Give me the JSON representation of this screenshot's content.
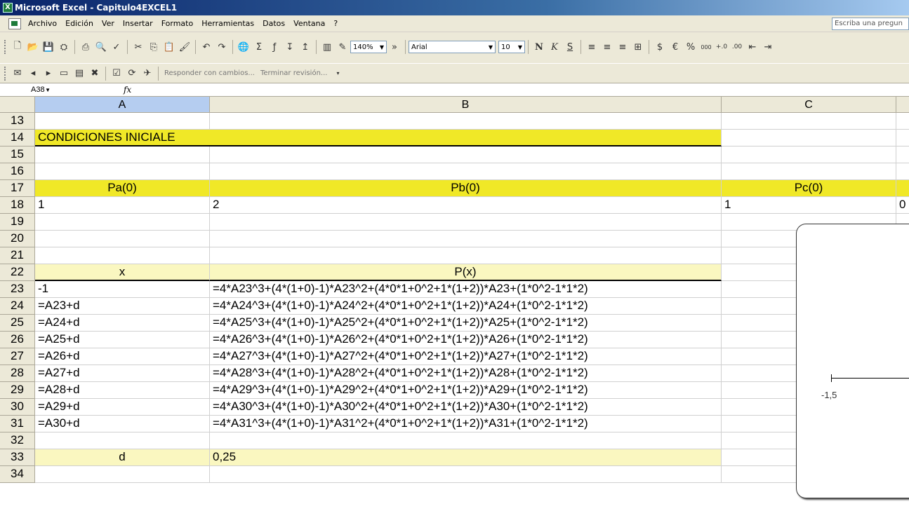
{
  "window": {
    "title": "Microsoft Excel - Capitulo4EXCEL1"
  },
  "menu": {
    "items": [
      "Archivo",
      "Edición",
      "Ver",
      "Insertar",
      "Formato",
      "Herramientas",
      "Datos",
      "Ventana",
      "?"
    ],
    "ask_placeholder": "Escriba una pregun"
  },
  "toolbar": {
    "zoom": "140%",
    "font": "Arial",
    "font_size": "10",
    "bold": "N",
    "italic": "K",
    "underline": "S",
    "review_reply": "Responder con cambios...",
    "review_end": "Terminar revisión..."
  },
  "formula_bar": {
    "name_box": "A38",
    "fx": "fx",
    "content": ""
  },
  "columns": [
    "A",
    "B",
    "C"
  ],
  "rows": [
    {
      "n": "13",
      "a": "",
      "b": "",
      "c": ""
    },
    {
      "n": "14",
      "a": "CONDICIONES INICIALE",
      "b": "",
      "c": ""
    },
    {
      "n": "15",
      "a": "",
      "b": "",
      "c": ""
    },
    {
      "n": "16",
      "a": "",
      "b": "",
      "c": ""
    },
    {
      "n": "17",
      "a": "Pa(0)",
      "b": "Pb(0)",
      "c": "Pc(0)"
    },
    {
      "n": "18",
      "a": "1",
      "b": "2",
      "c": "1",
      "d": "0"
    },
    {
      "n": "19",
      "a": "",
      "b": "",
      "c": ""
    },
    {
      "n": "20",
      "a": "",
      "b": "",
      "c": ""
    },
    {
      "n": "21",
      "a": "",
      "b": "",
      "c": ""
    },
    {
      "n": "22",
      "a": "x",
      "b": "P(x)",
      "c": ""
    },
    {
      "n": "23",
      "a": "-1",
      "b": "=4*A23^3+(4*(1+0)-1)*A23^2+(4*0*1+0^2+1*(1+2))*A23+(1*0^2-1*1*2)",
      "c": ""
    },
    {
      "n": "24",
      "a": "=A23+d",
      "b": "=4*A24^3+(4*(1+0)-1)*A24^2+(4*0*1+0^2+1*(1+2))*A24+(1*0^2-1*1*2)",
      "c": ""
    },
    {
      "n": "25",
      "a": "=A24+d",
      "b": "=4*A25^3+(4*(1+0)-1)*A25^2+(4*0*1+0^2+1*(1+2))*A25+(1*0^2-1*1*2)",
      "c": ""
    },
    {
      "n": "26",
      "a": "=A25+d",
      "b": "=4*A26^3+(4*(1+0)-1)*A26^2+(4*0*1+0^2+1*(1+2))*A26+(1*0^2-1*1*2)",
      "c": ""
    },
    {
      "n": "27",
      "a": "=A26+d",
      "b": "=4*A27^3+(4*(1+0)-1)*A27^2+(4*0*1+0^2+1*(1+2))*A27+(1*0^2-1*1*2)",
      "c": ""
    },
    {
      "n": "28",
      "a": "=A27+d",
      "b": "=4*A28^3+(4*(1+0)-1)*A28^2+(4*0*1+0^2+1*(1+2))*A28+(1*0^2-1*1*2)",
      "c": ""
    },
    {
      "n": "29",
      "a": "=A28+d",
      "b": "=4*A29^3+(4*(1+0)-1)*A29^2+(4*0*1+0^2+1*(1+2))*A29+(1*0^2-1*1*2)",
      "c": ""
    },
    {
      "n": "30",
      "a": "=A29+d",
      "b": "=4*A30^3+(4*(1+0)-1)*A30^2+(4*0*1+0^2+1*(1+2))*A30+(1*0^2-1*1*2)",
      "c": ""
    },
    {
      "n": "31",
      "a": "=A30+d",
      "b": "=4*A31^3+(4*(1+0)-1)*A31^2+(4*0*1+0^2+1*(1+2))*A31+(1*0^2-1*1*2)",
      "c": ""
    },
    {
      "n": "32",
      "a": "",
      "b": "",
      "c": ""
    },
    {
      "n": "33",
      "a": "d",
      "b": "0,25",
      "c": ""
    },
    {
      "n": "34",
      "a": "",
      "b": "",
      "c": ""
    }
  ],
  "chart": {
    "axis_label": "-1,5"
  },
  "colors": {
    "yellow": "#f0e827",
    "light_yellow": "#faf7c0",
    "selected_header": "#b5cdf0",
    "chrome": "#ece9d8"
  }
}
